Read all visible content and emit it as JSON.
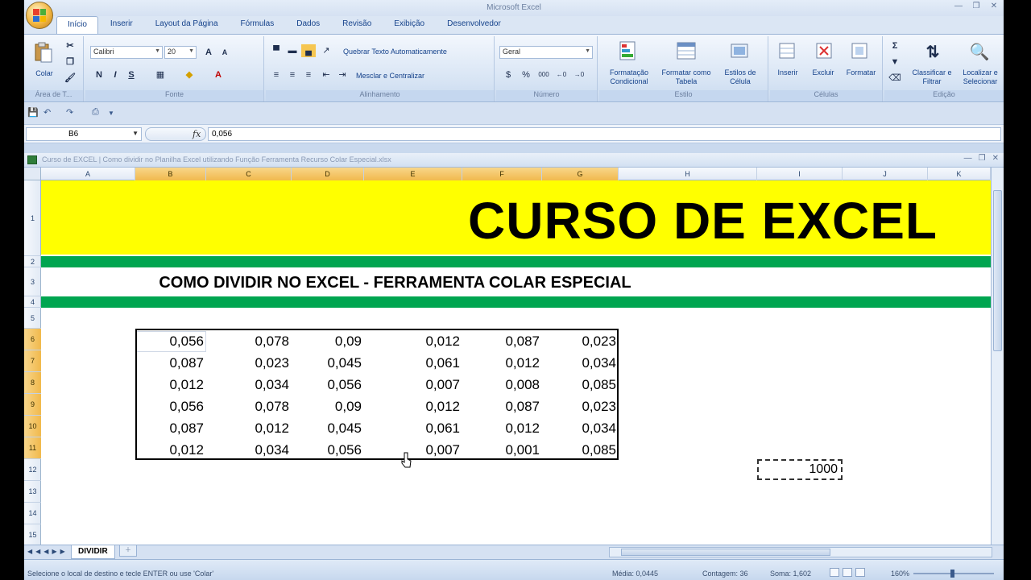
{
  "app": {
    "title": "Microsoft Excel",
    "window_controls": [
      "—",
      "❐",
      "✕"
    ]
  },
  "tabs": [
    "Início",
    "Inserir",
    "Layout da Página",
    "Fórmulas",
    "Dados",
    "Revisão",
    "Exibição",
    "Desenvolvedor"
  ],
  "ribbon": {
    "clipboard": {
      "paste_label": "Colar",
      "group_label": "Área de T..."
    },
    "font": {
      "name": "Calibri",
      "size": "20",
      "group_label": "Fonte"
    },
    "alignment": {
      "wrap_text": "Quebrar Texto Automaticamente",
      "merge_center": "Mesclar e Centralizar",
      "group_label": "Alinhamento"
    },
    "number": {
      "format": "Geral",
      "group_label": "Número"
    },
    "styles": {
      "cond_format": "Formatação Condicional",
      "format_table": "Formatar como Tabela",
      "cell_styles": "Estilos de Célula",
      "group_label": "Estilo"
    },
    "cells": {
      "insert": "Inserir",
      "delete": "Excluir",
      "format": "Formatar",
      "group_label": "Células"
    },
    "editing": {
      "sort_filter": "Classificar e Filtrar",
      "find_select": "Localizar e Selecionar",
      "group_label": "Edição"
    }
  },
  "formula_bar": {
    "name_box": "B6",
    "fx": "fx",
    "formula": "0,056"
  },
  "workbook": {
    "title": "Curso de EXCEL | Como dividir no Planilha Excel utilizando Função Ferramenta Recurso Colar Especial.xlsx",
    "controls": [
      "—",
      "❐",
      "✕"
    ]
  },
  "columns": [
    "A",
    "B",
    "C",
    "D",
    "E",
    "F",
    "G",
    "H",
    "I",
    "J",
    "K"
  ],
  "rows": [
    "1",
    "2",
    "3",
    "4",
    "5",
    "6",
    "7",
    "8",
    "9",
    "10",
    "11",
    "12",
    "13",
    "14",
    "15"
  ],
  "sheet": {
    "main_title": "CURSO DE EXCEL",
    "subtitle": "COMO DIVIDIR NO EXCEL - FERRAMENTA COLAR ESPECIAL",
    "data": [
      [
        "0,056",
        "0,078",
        "0,09",
        "0,012",
        "0,087",
        "0,023"
      ],
      [
        "0,087",
        "0,023",
        "0,045",
        "0,061",
        "0,012",
        "0,034"
      ],
      [
        "0,012",
        "0,034",
        "0,056",
        "0,007",
        "0,008",
        "0,085"
      ],
      [
        "0,056",
        "0,078",
        "0,09",
        "0,012",
        "0,087",
        "0,023"
      ],
      [
        "0,087",
        "0,012",
        "0,045",
        "0,061",
        "0,012",
        "0,034"
      ],
      [
        "0,012",
        "0,034",
        "0,056",
        "0,007",
        "0,001",
        "0,085"
      ]
    ],
    "copied_value": "1000",
    "tab_name": "DIVIDIR"
  },
  "status": {
    "message": "Selecione o local de destino e tecle ENTER ou use 'Colar'",
    "average": "Média: 0,0445",
    "count": "Contagem: 36",
    "sum": "Soma: 1,602",
    "zoom": "160%"
  },
  "colors": {
    "title_band": "#ffff00",
    "green_band": "#00a550",
    "header_selected": "#f1b94c"
  }
}
